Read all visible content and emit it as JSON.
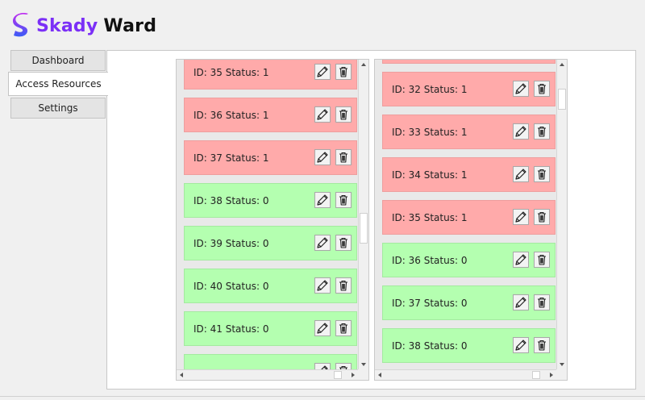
{
  "app": {
    "title_part1": "Skady",
    "title_part2": "Ward",
    "brand_color": "#7b2ff7"
  },
  "tabs": [
    {
      "label": "Dashboard",
      "active": false
    },
    {
      "label": "Access Resources",
      "active": true
    },
    {
      "label": "Settings",
      "active": false
    }
  ],
  "colors": {
    "status_1": "#ffaaaa",
    "status_0": "#b4ffb0"
  },
  "lists": [
    {
      "name": "list-left",
      "items": [
        {
          "label": "ID: 35  Status: 1",
          "status": 1
        },
        {
          "label": "ID: 36  Status: 1",
          "status": 1
        },
        {
          "label": "ID: 37  Status: 1",
          "status": 1
        },
        {
          "label": "ID: 38  Status: 0",
          "status": 0
        },
        {
          "label": "ID: 39  Status: 0",
          "status": 0
        },
        {
          "label": "ID: 40  Status: 0",
          "status": 0
        },
        {
          "label": "ID: 41  Status: 0",
          "status": 0
        },
        {
          "label": "",
          "status": 0
        }
      ]
    },
    {
      "name": "list-right",
      "items": [
        {
          "label": "",
          "status": 1
        },
        {
          "label": "ID: 32  Status: 1",
          "status": 1
        },
        {
          "label": "ID: 33  Status: 1",
          "status": 1
        },
        {
          "label": "ID: 34  Status: 1",
          "status": 1
        },
        {
          "label": "ID: 35  Status: 1",
          "status": 1
        },
        {
          "label": "ID: 36  Status: 0",
          "status": 0
        },
        {
          "label": "ID: 37  Status: 0",
          "status": 0
        },
        {
          "label": "ID: 38  Status: 0",
          "status": 0
        }
      ]
    }
  ],
  "icons": {
    "edit": "pencil-icon",
    "delete": "trash-icon"
  }
}
